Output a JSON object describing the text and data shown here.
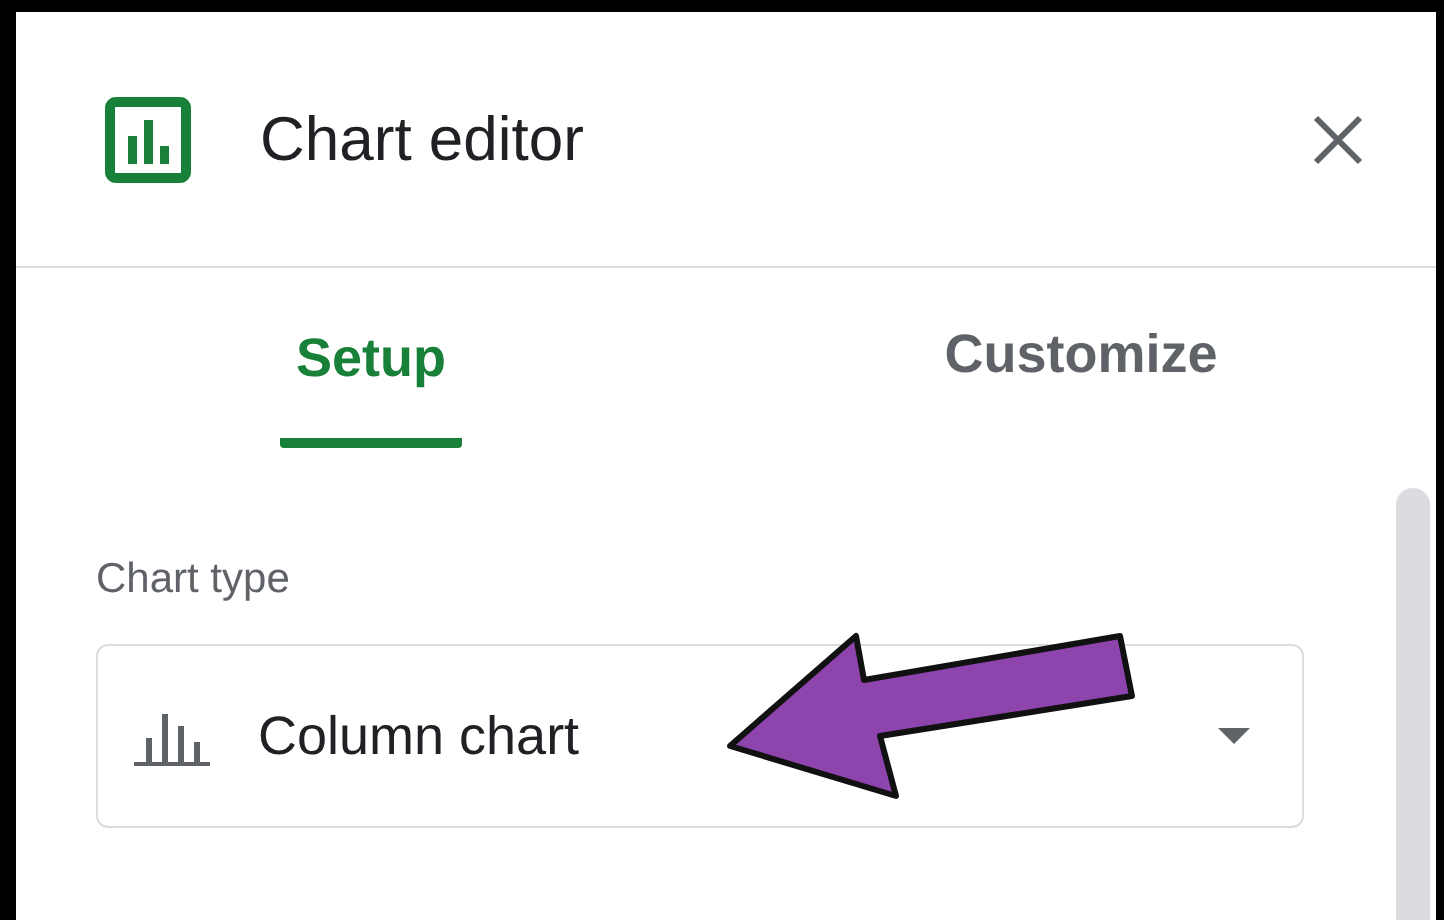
{
  "header": {
    "title": "Chart editor"
  },
  "tabs": [
    {
      "label": "Setup",
      "selected": true
    },
    {
      "label": "Customize",
      "selected": false
    }
  ],
  "chart_type": {
    "label": "Chart type",
    "value": "Column chart"
  }
}
